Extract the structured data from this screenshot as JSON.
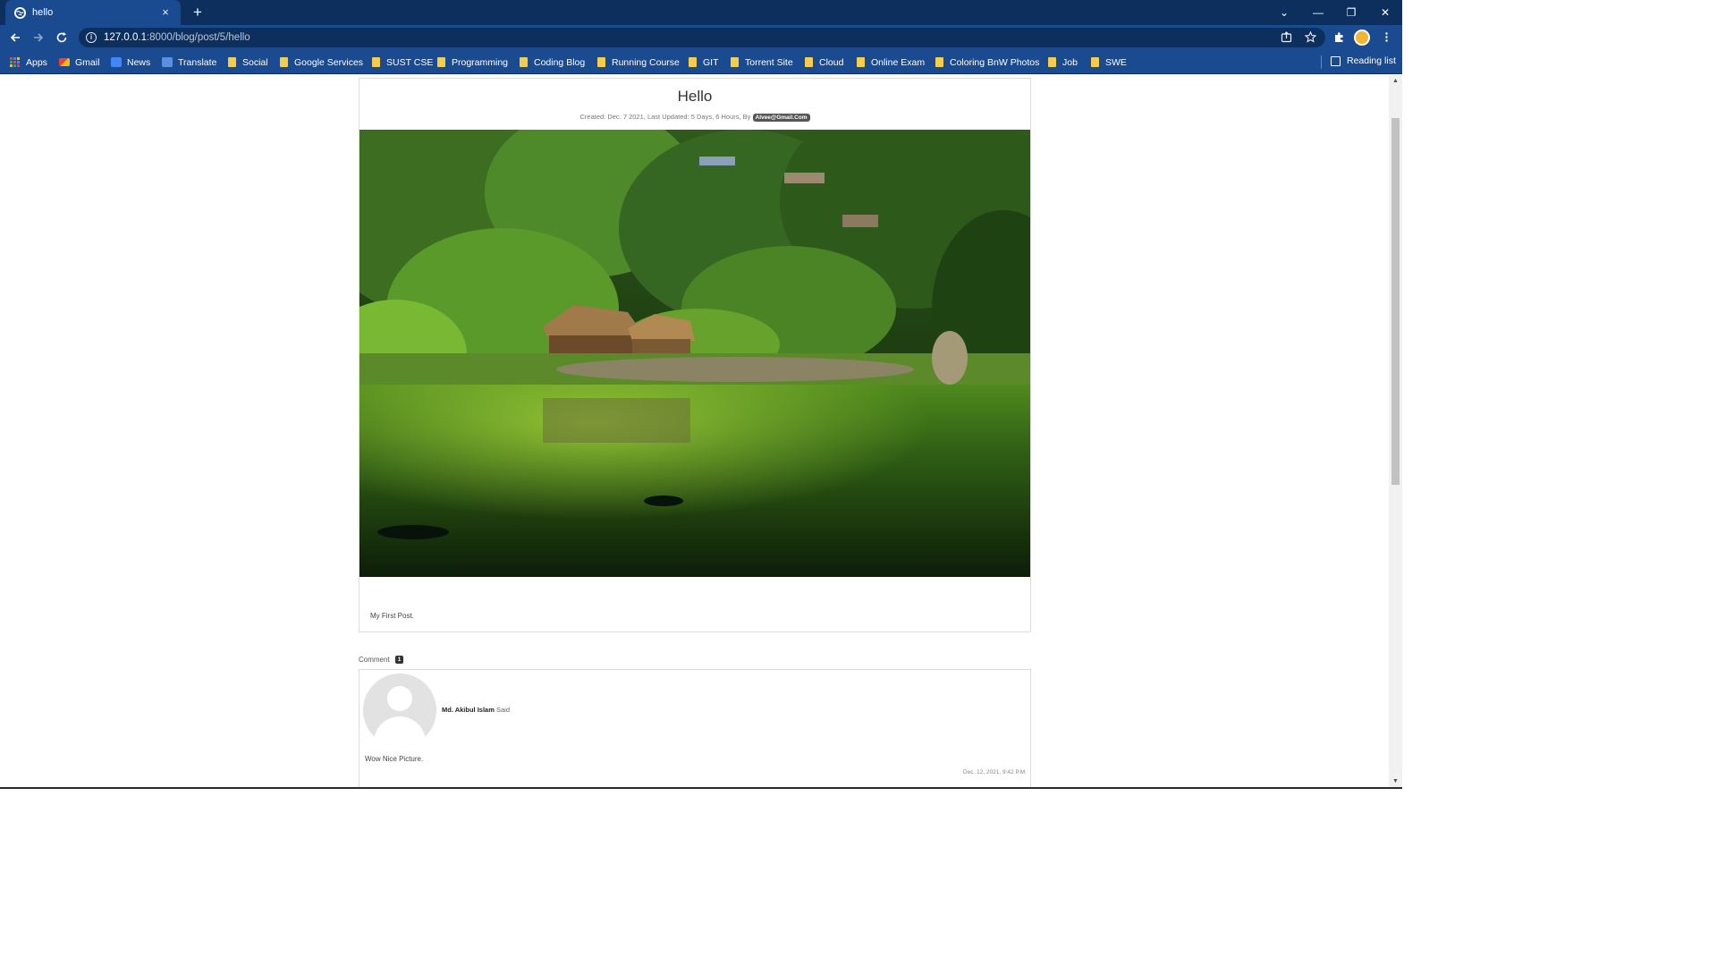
{
  "browser": {
    "tab_title": "hello",
    "tab_close": "×",
    "new_tab": "+",
    "url_host": "127.0.0.1",
    "url_path": ":8000/blog/post/5/hello",
    "window_controls": {
      "tab_search": "⌄",
      "minimize": "—",
      "restore": "❐",
      "close": "✕"
    }
  },
  "bookmarks": [
    {
      "label": "Apps",
      "icon": "apps-grid-icon"
    },
    {
      "label": "Gmail",
      "icon": "gmail-icon"
    },
    {
      "label": "News",
      "icon": "google-news-icon"
    },
    {
      "label": "Translate",
      "icon": "google-translate-icon"
    },
    {
      "label": "Social",
      "icon": "folder-icon"
    },
    {
      "label": "Google Services",
      "icon": "folder-icon"
    },
    {
      "label": "SUST CSE",
      "icon": "folder-icon"
    },
    {
      "label": "Programming",
      "icon": "folder-icon"
    },
    {
      "label": "Coding Blog",
      "icon": "folder-icon"
    },
    {
      "label": "Running Course",
      "icon": "folder-icon"
    },
    {
      "label": "GIT",
      "icon": "folder-icon"
    },
    {
      "label": "Torrent Site",
      "icon": "folder-icon"
    },
    {
      "label": "Cloud",
      "icon": "folder-icon"
    },
    {
      "label": "Online Exam",
      "icon": "folder-icon"
    },
    {
      "label": "Coloring BnW Photos",
      "icon": "folder-icon"
    },
    {
      "label": "Job",
      "icon": "folder-icon"
    },
    {
      "label": "SWE",
      "icon": "folder-icon"
    }
  ],
  "reading_list": "Reading list",
  "post": {
    "title": "Hello",
    "meta": "Created: Dec. 7 2021, Last Updated: 5 Days, 6 Hours, By",
    "author": "Alvee@Gmail.Com",
    "image_icon": "landscape-photo",
    "body": "My First Post."
  },
  "comments": {
    "label": "Comment",
    "count": "1",
    "items": [
      {
        "author": "Md. Akibul Islam",
        "said": "Said",
        "text": "Wow Nice Picture.",
        "date": "Dec. 12, 2021, 9:42 P.M."
      }
    ]
  },
  "colors": {
    "browser_frame": "#0d2f5e",
    "browser_toolbar": "#1a4a8f",
    "bookmark_folder": "#f5cd4d",
    "card_border": "#dcdcdc"
  }
}
